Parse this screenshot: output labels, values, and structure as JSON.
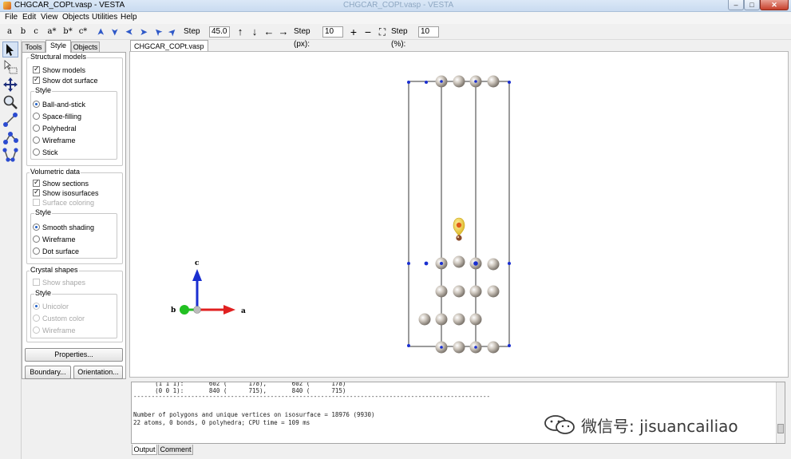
{
  "window": {
    "title": "CHGCAR_COPt.vasp - VESTA",
    "faded_title": "CHGCAR_COPt.vasp - VESTA",
    "btn_min": "–",
    "btn_max": "□",
    "btn_close": "✕"
  },
  "menu": [
    "File",
    "Edit",
    "View",
    "Objects",
    "Utilities",
    "Help"
  ],
  "toolbar": {
    "axis_buttons": [
      "a",
      "b",
      "c",
      "a*",
      "b*",
      "c*"
    ],
    "rotate_glyphs": [
      "➤",
      "➤",
      "➤",
      "➤",
      "➤",
      "➤"
    ],
    "step_deg_label": "Step (°):",
    "step_deg_value": "45.0",
    "pan_glyphs": [
      "↑",
      "↓",
      "←",
      "→"
    ],
    "step_px_label": "Step (px):",
    "step_px_value": "10",
    "zoom_in": "+",
    "zoom_out": "−",
    "fit_glyph": "⛶",
    "step_pct_label": "Step (%):",
    "step_pct_value": "10"
  },
  "left_tools": [
    "select-arrow-icon",
    "select-region-icon",
    "translate-icon",
    "magnify-icon",
    "distance-icon",
    "angle-icon",
    "dihedral-icon"
  ],
  "panel": {
    "tabs": [
      "Tools",
      "Style",
      "Objects"
    ],
    "active_tab": "Style",
    "structural": {
      "title": "Structural models",
      "show_models": "Show models",
      "show_dot_surface": "Show dot surface",
      "style_title": "Style",
      "styles": [
        "Ball-and-stick",
        "Space-filling",
        "Polyhedral",
        "Wireframe",
        "Stick"
      ],
      "selected_style": "Ball-and-stick"
    },
    "volumetric": {
      "title": "Volumetric data",
      "show_sections": "Show sections",
      "show_isosurfaces": "Show isosurfaces",
      "surface_coloring": "Surface coloring",
      "style_title": "Style",
      "styles": [
        "Smooth shading",
        "Wireframe",
        "Dot surface"
      ],
      "selected_style": "Smooth shading"
    },
    "crystal": {
      "title": "Crystal shapes",
      "show_shapes": "Show shapes",
      "style_title": "Style",
      "styles": [
        "Unicolor",
        "Custom color",
        "Wireframe"
      ]
    },
    "properties_btn": "Properties...",
    "boundary_btn": "Boundary...",
    "orientation_btn": "Orientation..."
  },
  "document_tab": "CHGCAR_COPt.vasp",
  "axes": {
    "a": "a",
    "b": "b",
    "c": "c"
  },
  "colors": {
    "a_axis": "#e02020",
    "b_axis": "#20c020",
    "c_axis": "#1a2fd0",
    "atom_pt": "#cfc8bf",
    "atom_o": "#e05a1a",
    "atom_c": "#8a4a2a",
    "isosurface": "#f3d43a"
  },
  "output": {
    "lines": [
      "      (1 1 1):       602 (      178),       602 (      178)",
      "      (0 0 1):       840 (      715),       840 (      715)",
      "---------------------------------------------------------------------------------------------------",
      "",
      "Number of polygons and unique vertices on isosurface = 18976 (9930)",
      "22 atoms, 0 bonds, 0 polyhedra; CPU time = 109 ms"
    ]
  },
  "bottom_tabs": [
    "Output",
    "Comment"
  ],
  "watermark": "微信号: jisuancailiao"
}
